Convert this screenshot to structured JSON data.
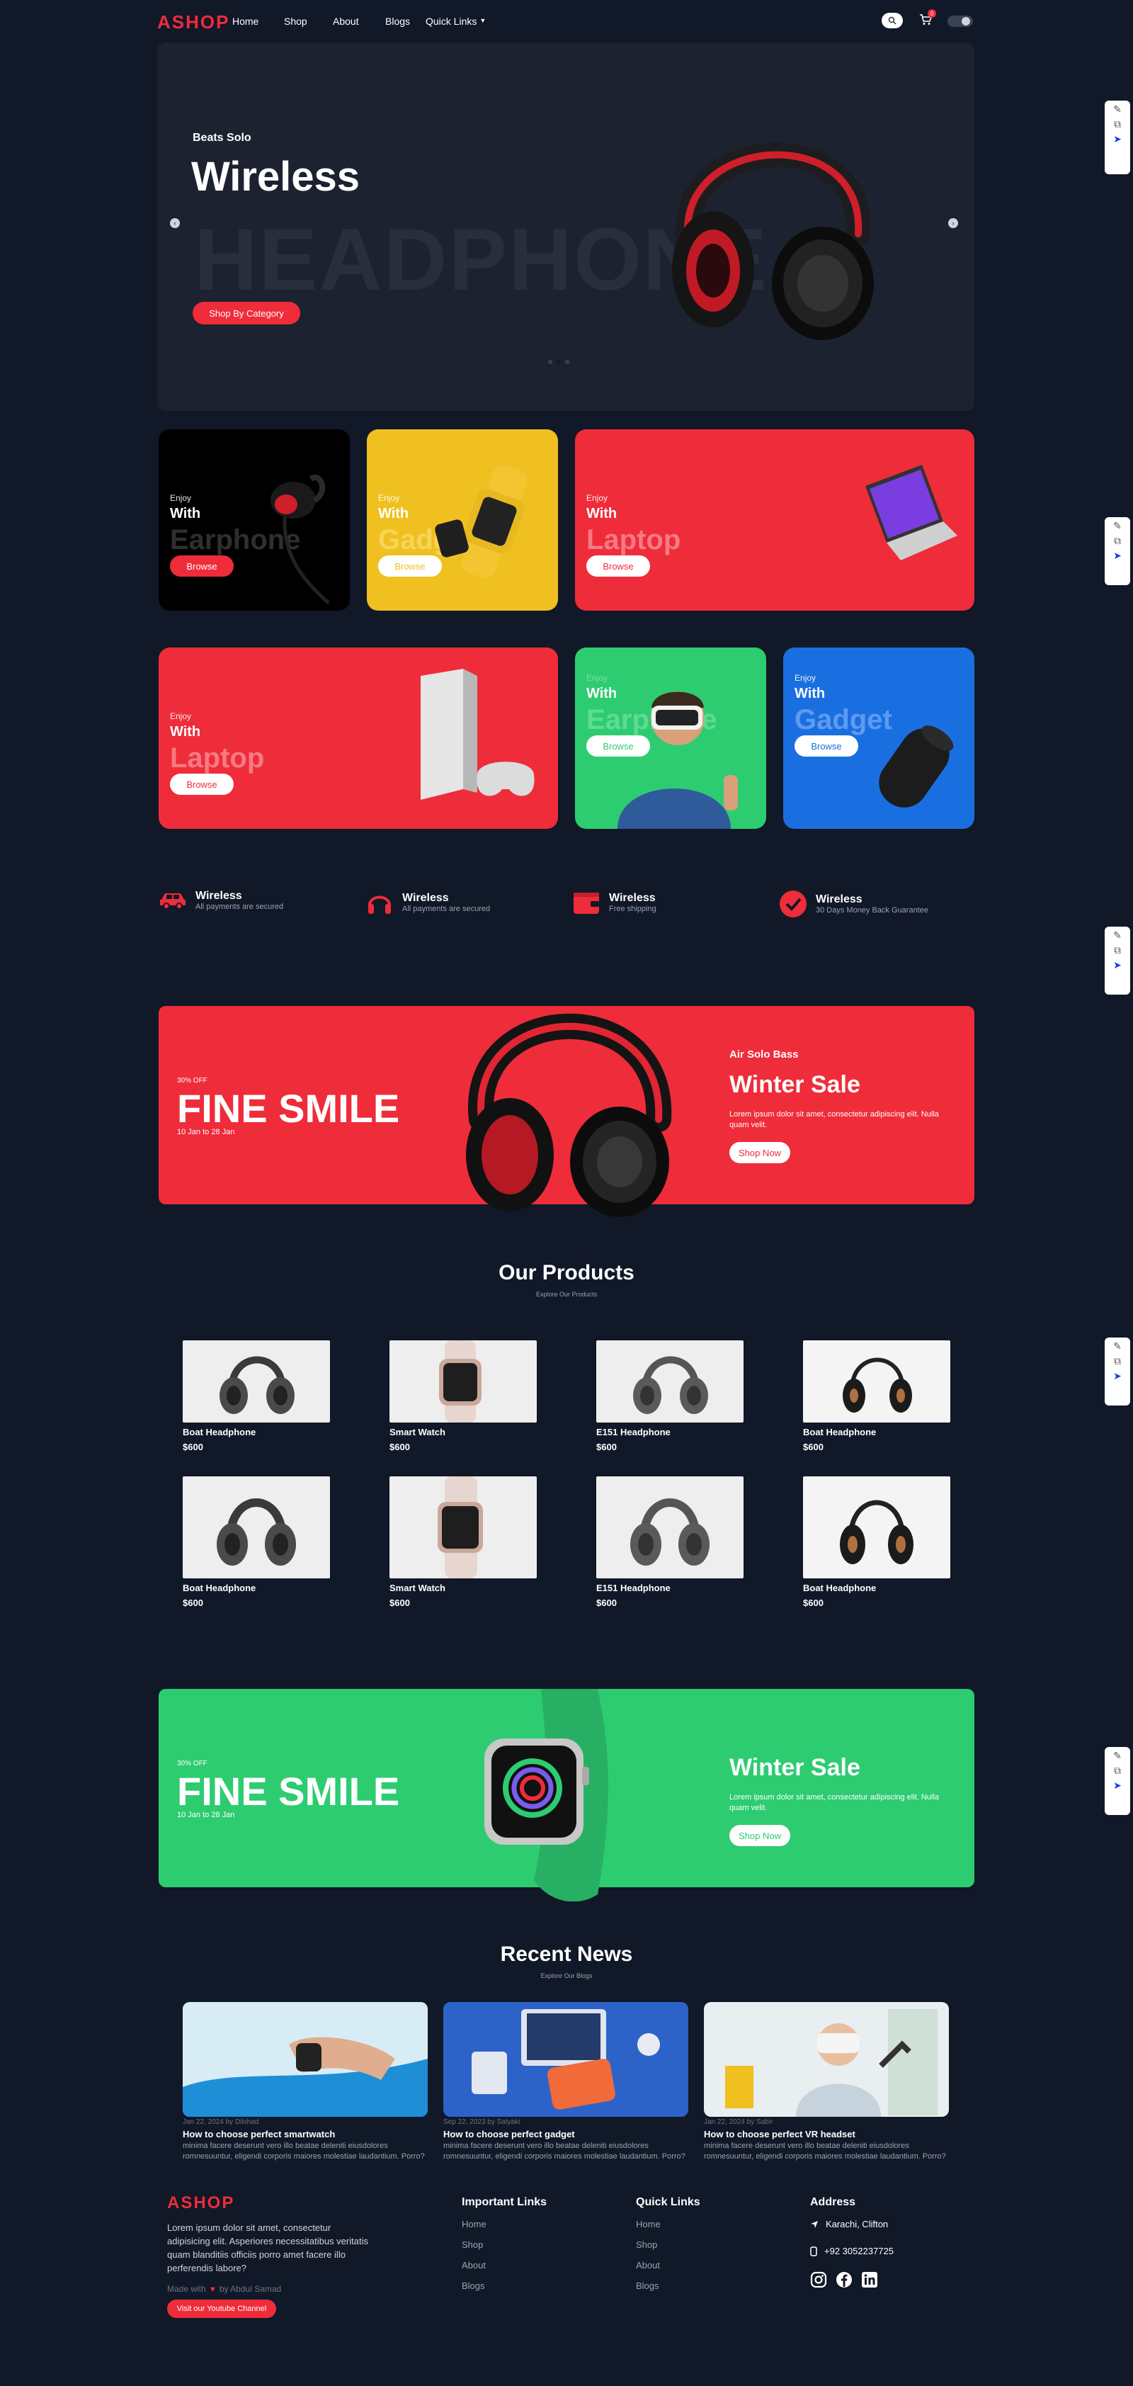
{
  "nav": {
    "logo": "ASHOP",
    "links": [
      "Home",
      "Shop",
      "About",
      "Blogs",
      "Quick Links"
    ],
    "cart_count": "0"
  },
  "hero": {
    "subtitle": "Beats Solo",
    "title": "Wireless",
    "bg_text": "HEADPHONE",
    "cta": "Shop By Category"
  },
  "cards": [
    {
      "enjoy": "Enjoy",
      "with": "With",
      "big": "Earphone",
      "btn": "Browse"
    },
    {
      "enjoy": "Enjoy",
      "with": "With",
      "big": "Gadget",
      "btn": "Browse"
    },
    {
      "enjoy": "Enjoy",
      "with": "With",
      "big": "Laptop",
      "btn": "Browse"
    },
    {
      "enjoy": "Enjoy",
      "with": "With",
      "big": "Laptop",
      "btn": "Browse"
    },
    {
      "enjoy": "Enjoy",
      "with": "With",
      "big": "Earphone",
      "btn": "Browse"
    },
    {
      "enjoy": "Enjoy",
      "with": "With",
      "big": "Gadget",
      "btn": "Browse"
    }
  ],
  "features": [
    {
      "title": "Wireless",
      "sub": "All payments are secured"
    },
    {
      "title": "Wireless",
      "sub": "All payments are secured"
    },
    {
      "title": "Wireless",
      "sub": "Free shipping"
    },
    {
      "title": "Wireless",
      "sub": "30 Days Money Back Guarantee"
    }
  ],
  "banner1": {
    "discount": "30% OFF",
    "title": "FINE SMILE",
    "dates": "10 Jan to 28 Jan",
    "product": "Air Solo Bass",
    "sale": "Winter Sale",
    "desc": "Lorem ipsum dolor sit amet, consectetur adipiscing elit. Nulla quam velit.",
    "btn": "Shop Now"
  },
  "products_section": {
    "title": "Our Products",
    "subtitle": "Explore Our Products",
    "items": [
      {
        "name": "Boat Headphone",
        "price": "$600"
      },
      {
        "name": "Smart Watch",
        "price": "$600"
      },
      {
        "name": "E151 Headphone",
        "price": "$600"
      },
      {
        "name": "Boat Headphone",
        "price": "$600"
      },
      {
        "name": "Boat Headphone",
        "price": "$600"
      },
      {
        "name": "Smart Watch",
        "price": "$600"
      },
      {
        "name": "E151 Headphone",
        "price": "$600"
      },
      {
        "name": "Boat Headphone",
        "price": "$600"
      }
    ]
  },
  "banner2": {
    "discount": "30% OFF",
    "title": "FINE SMILE",
    "dates": "10 Jan to 28 Jan",
    "sale": "Winter Sale",
    "desc": "Lorem ipsum dolor sit amet, consectetur adipiscing elit. Nulla quam velit.",
    "btn": "Shop Now"
  },
  "news_section": {
    "title": "Recent News",
    "subtitle": "Explore Our Blogs",
    "items": [
      {
        "meta": "Jan 22, 2024 by Dilshad",
        "title": "How to choose perfect smartwatch",
        "text": "minima facere deserunt vero illo beatae deleniti eiusdolores romnesuuntur, eligendi corporis maiores molestiae laudantium. Porro?"
      },
      {
        "meta": "Sep 22, 2023 by Satyaki",
        "title": "How to choose perfect gadget",
        "text": "minima facere deserunt vero illo beatae deleniti eiusdolores romnesuuntur, eligendi corporis maiores molestiae laudantium. Porro?"
      },
      {
        "meta": "Jan 22, 2024 by Sabir",
        "title": "How to choose perfect VR headset",
        "text": "minima facere deserunt vero illo beatae deleniti eiusdolores romnesuuntur, eligendi corporis maiores molestiae laudantium. Porro?"
      }
    ]
  },
  "footer": {
    "logo": "ASHOP",
    "about": "Lorem ipsum dolor sit amet, consectetur adipisicing elit. Asperiores necessitatibus veritatis quam blanditiis officiis porro amet facere illo perferendis labore?",
    "made_with": "Made with",
    "made_by": "by Abdul Samad",
    "yt_btn": "Visit our Youtube Channel",
    "important_title": "Important Links",
    "important_links": [
      "Home",
      "Shop",
      "About",
      "Blogs"
    ],
    "quick_title": "Quick Links",
    "quick_links": [
      "Home",
      "Shop",
      "About",
      "Blogs"
    ],
    "address_title": "Address",
    "location": "Karachi, Clifton",
    "phone": "+92 3052237725"
  },
  "colors": {
    "accent": "#ef2c3a",
    "bg": "#111827",
    "green": "#2ecc71",
    "blue": "#1a6fe0",
    "yellow": "#f0c020"
  }
}
